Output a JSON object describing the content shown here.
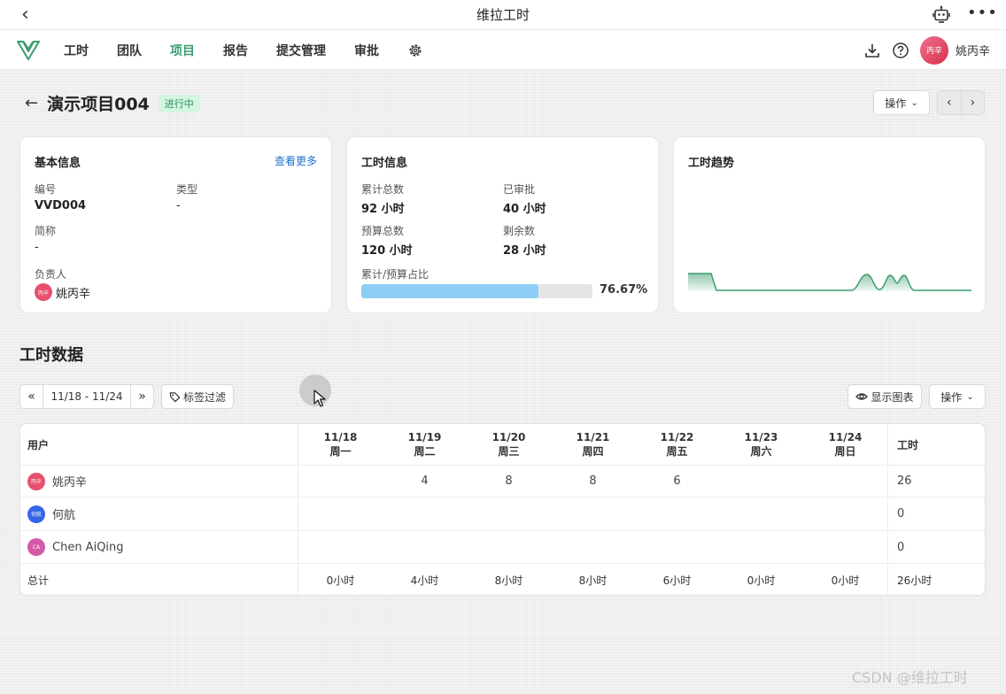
{
  "window": {
    "title": "维拉工时",
    "more_icon": "more-horizontal-icon"
  },
  "nav": {
    "items": [
      {
        "label": "工时"
      },
      {
        "label": "团队"
      },
      {
        "label": "项目"
      },
      {
        "label": "报告"
      },
      {
        "label": "提交管理"
      },
      {
        "label": "审批"
      }
    ],
    "active": "项目",
    "accent_color": "#3a9d6e",
    "user": {
      "name": "姚丙辛",
      "avatar_text": "丙辛"
    }
  },
  "project": {
    "title": "演示项目004",
    "status": "进行中",
    "op_label": "操作"
  },
  "basic_info": {
    "title": "基本信息",
    "more_link": "查看更多",
    "code_label": "编号",
    "code_value": "VVD004",
    "type_label": "类型",
    "type_value": "-",
    "alias_label": "简称",
    "alias_value": "-",
    "owner_label": "负责人",
    "owner_name": "姚丙辛",
    "owner_avatar_text": "丙辛"
  },
  "hours_info": {
    "title": "工时信息",
    "total_label": "累计总数",
    "total_value": "92 小时",
    "approved_label": "已审批",
    "approved_value": "40 小时",
    "budget_label": "预算总数",
    "budget_value": "120 小时",
    "remaining_label": "剩余数",
    "remaining_value": "28 小时",
    "ratio_label": "累计/预算占比",
    "ratio_text": "76.67%",
    "ratio_value": 0.7667
  },
  "trend": {
    "title": "工时趋势",
    "color": "#3a9d6e"
  },
  "hours_data": {
    "title": "工时数据",
    "date_range": "11/18 - 11/24",
    "tag_filter_label": "标签过滤",
    "show_chart_label": "显示图表",
    "op_label": "操作"
  },
  "table": {
    "user_header": "用户",
    "total_header": "工时",
    "days": [
      {
        "date": "11/18",
        "weekday": "周一"
      },
      {
        "date": "11/19",
        "weekday": "周二"
      },
      {
        "date": "11/20",
        "weekday": "周三"
      },
      {
        "date": "11/21",
        "weekday": "周四"
      },
      {
        "date": "11/22",
        "weekday": "周五"
      },
      {
        "date": "11/23",
        "weekday": "周六"
      },
      {
        "date": "11/24",
        "weekday": "周日"
      }
    ],
    "rows": [
      {
        "name": "姚丙辛",
        "avatar_text": "丙辛",
        "avatar_color": "#e5506d",
        "values": [
          "",
          "4",
          "8",
          "8",
          "6",
          "",
          ""
        ],
        "total": "26"
      },
      {
        "name": "何航",
        "avatar_text": "何航",
        "avatar_color": "#3366e8",
        "values": [
          "",
          "",
          "",
          "",
          "",
          "",
          ""
        ],
        "total": "0"
      },
      {
        "name": "Chen AiQing",
        "avatar_text": "CA",
        "avatar_color": "#d35aa8",
        "values": [
          "",
          "",
          "",
          "",
          "",
          "",
          ""
        ],
        "total": "0"
      }
    ],
    "total_row": {
      "label": "总计",
      "values": [
        "0小时",
        "4小时",
        "8小时",
        "8小时",
        "6小时",
        "0小时",
        "0小时"
      ],
      "total": "26小时"
    }
  },
  "watermark": "CSDN @维拉工时"
}
